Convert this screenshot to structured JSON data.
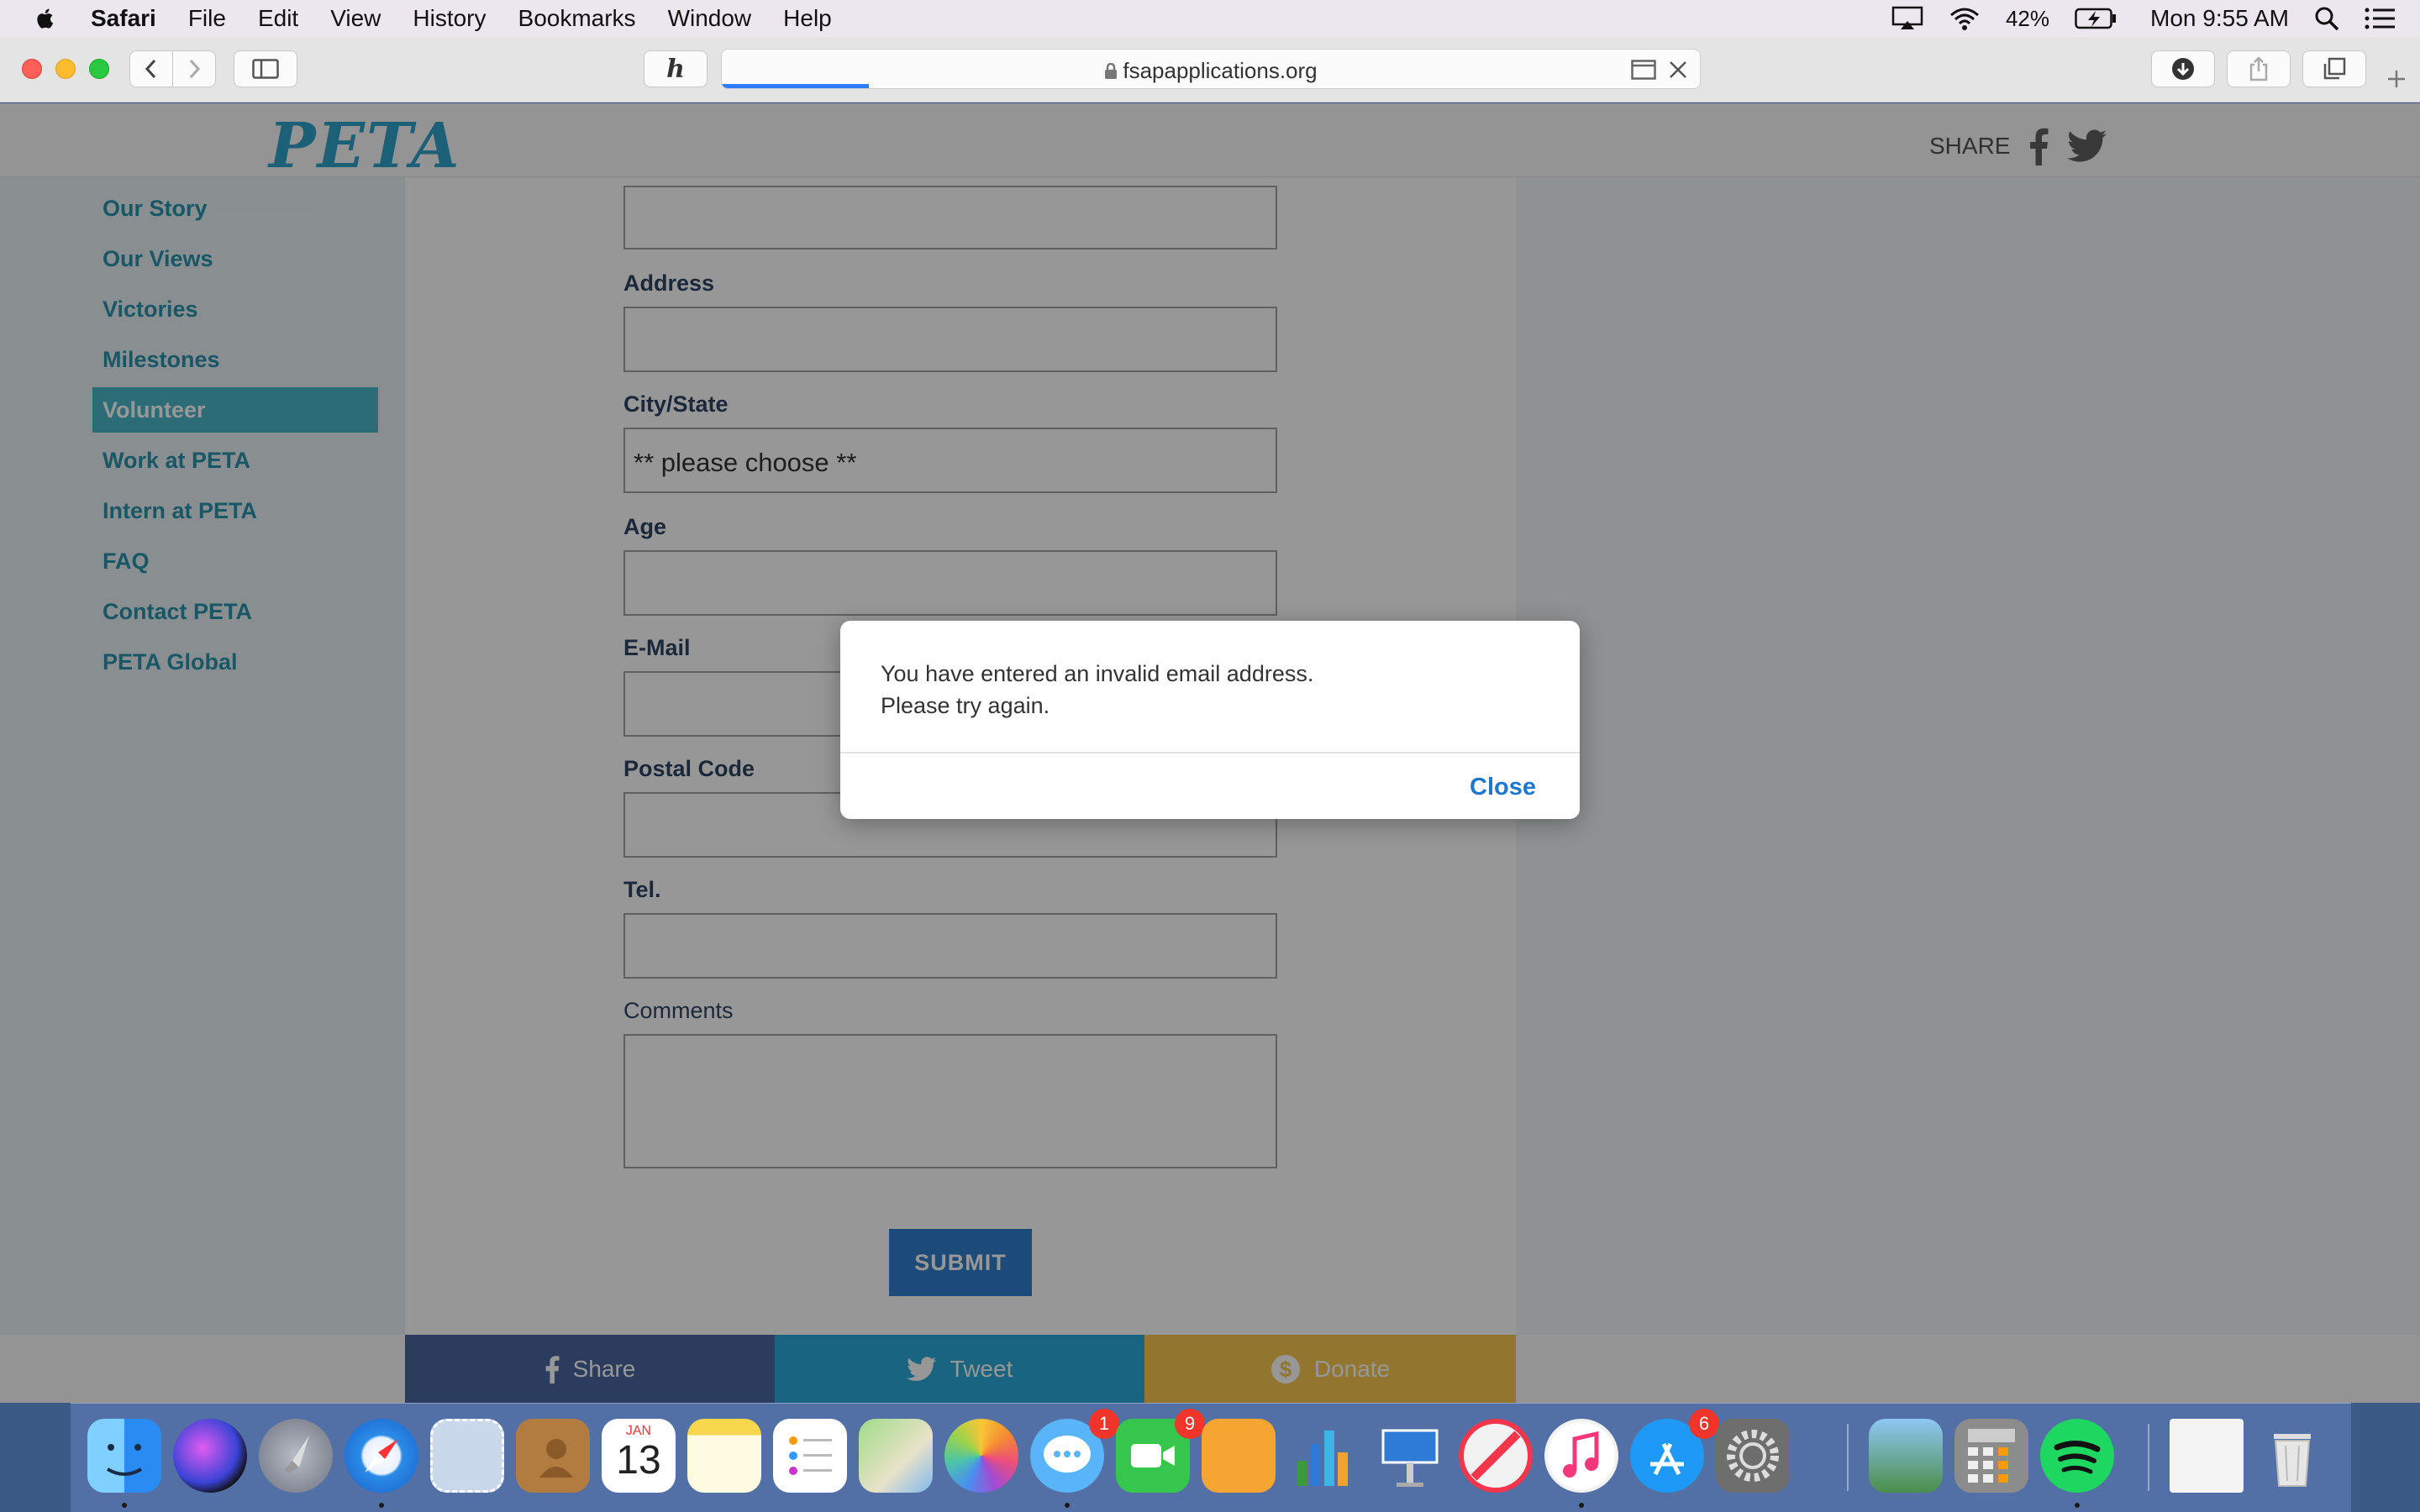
{
  "menubar": {
    "app": "Safari",
    "items": [
      "File",
      "Edit",
      "View",
      "History",
      "Bookmarks",
      "Window",
      "Help"
    ],
    "battery": "42%",
    "clock": "Mon 9:55 AM"
  },
  "browser": {
    "url": "fsapapplications.org",
    "page_load_progress": 0.15
  },
  "site": {
    "logo": "PETA",
    "share_label": "SHARE",
    "nav": [
      "Our Story",
      "Our Views",
      "Victories",
      "Milestones",
      "Volunteer",
      "Work at PETA",
      "Intern at PETA",
      "FAQ",
      "Contact PETA",
      "PETA Global"
    ],
    "active_nav": "Volunteer"
  },
  "form": {
    "address_label": "Address",
    "city_state_label": "City/State",
    "city_state_value": "** please choose **",
    "age_label": "Age",
    "email_label": "E-Mail",
    "postal_label": "Postal Code",
    "tel_label": "Tel.",
    "comments_label": "Comments",
    "submit_label": "SUBMIT"
  },
  "share_bar": {
    "share": "Share",
    "tweet": "Tweet",
    "donate": "Donate"
  },
  "dialog": {
    "message": "You have entered an invalid email address.\n Please try again.",
    "close": "Close"
  },
  "dock": {
    "messages_badge": "1",
    "facetime_badge": "9",
    "appstore_badge": "6",
    "calendar_month": "JAN",
    "calendar_day": "13"
  },
  "colors": {
    "peta_blue": "#1e9bc4",
    "facebook": "#3b5a98",
    "twitter": "#1aa3d6",
    "donate": "#f6c343",
    "link_blue": "#1f78cf"
  }
}
